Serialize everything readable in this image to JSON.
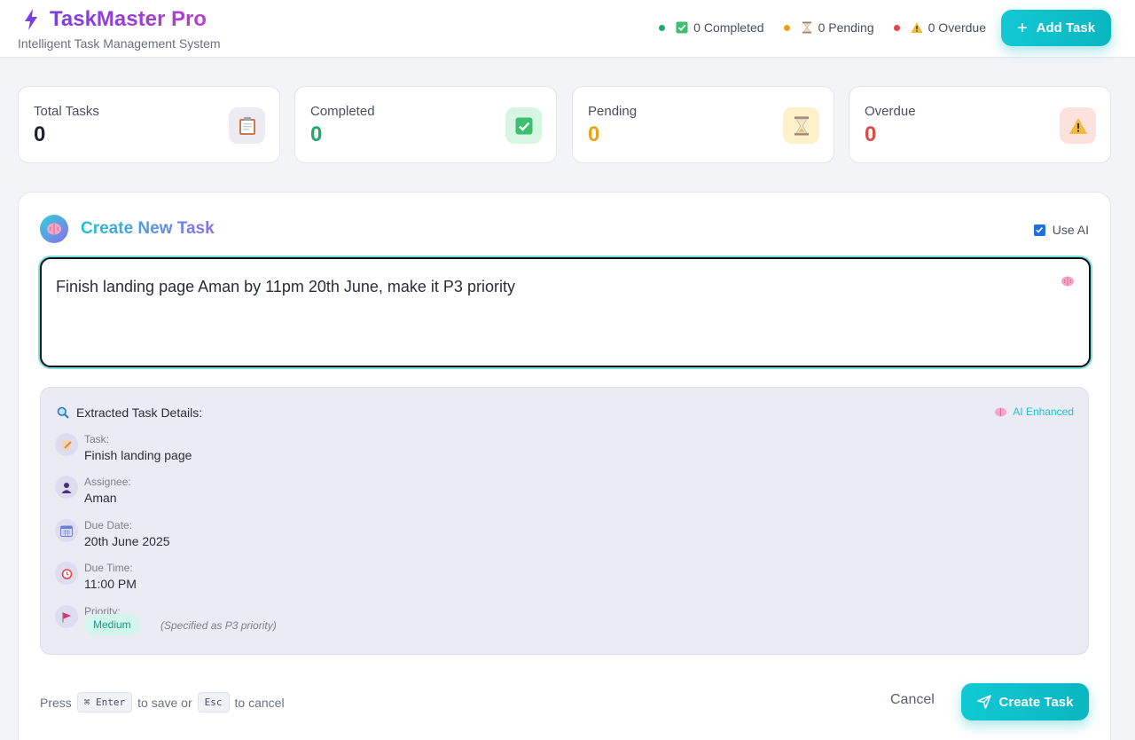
{
  "app": {
    "title": "TaskMaster Pro",
    "subtitle": "Intelligent Task Management System"
  },
  "header_stats": {
    "completed": "0 Completed",
    "pending": "0 Pending",
    "overdue": "0 Overdue"
  },
  "add_task_label": "Add Task",
  "cards": [
    {
      "label": "Total Tasks",
      "value": "0",
      "color": "#1f2233",
      "icon": "clipboard-icon"
    },
    {
      "label": "Completed",
      "value": "0",
      "color": "#22a86b",
      "icon": "check-box-icon"
    },
    {
      "label": "Pending",
      "value": "0",
      "color": "#e8a317",
      "icon": "hourglass-icon"
    },
    {
      "label": "Overdue",
      "value": "0",
      "color": "#e04848",
      "icon": "warning-icon"
    }
  ],
  "panel": {
    "title": "Create New Task",
    "use_ai_label": "Use AI",
    "use_ai_checked": true,
    "input_text": "Finish landing page Aman by 11pm 20th June, make it P3 priority"
  },
  "details": {
    "heading": "Extracted Task Details:",
    "ai_badge": "AI Enhanced",
    "task_label": "Task:",
    "task_value": "Finish landing page",
    "assignee_label": "Assignee:",
    "assignee_value": "Aman",
    "due_date_label": "Due Date:",
    "due_date_value": "20th June 2025",
    "due_time_label": "Due Time:",
    "due_time_value": "11:00 PM",
    "priority_label": "Priority:",
    "priority_value": "Medium",
    "priority_note": "(Specified as P3 priority)"
  },
  "footer": {
    "press": "Press",
    "enter_key": "⌘ Enter",
    "to_save_or": "to save or",
    "esc_key": "Esc",
    "to_cancel": "to cancel",
    "cancel_label": "Cancel",
    "create_label": "Create Task"
  },
  "colors": {
    "accent": "#0ab6bf",
    "brand": "#7a3fe0",
    "completed": "#22a86b",
    "pending": "#e8a317",
    "overdue": "#e04848"
  }
}
